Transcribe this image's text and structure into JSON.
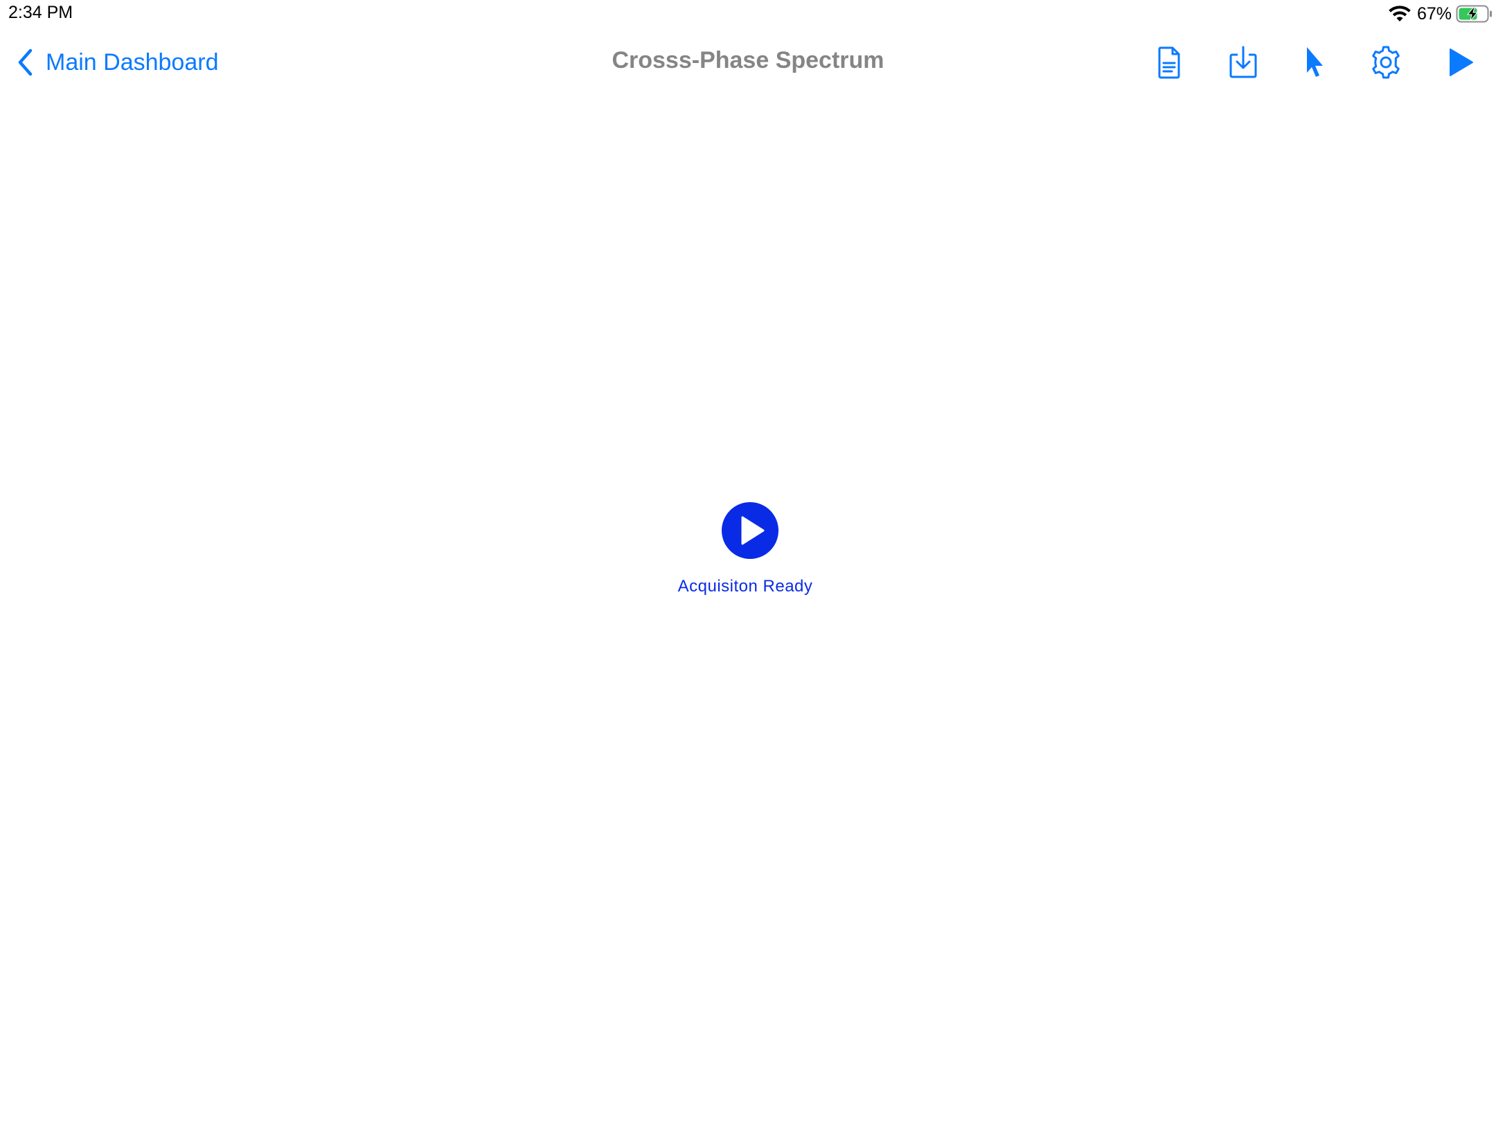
{
  "status_bar": {
    "time": "2:34 PM",
    "battery_percent": "67%",
    "battery_level": 0.67,
    "charging": true,
    "icons": [
      "wifi-icon",
      "battery-charging-icon"
    ]
  },
  "nav": {
    "back_label": "Main Dashboard",
    "title": "Crosss-Phase Spectrum",
    "toolbar_icons": [
      "document-icon",
      "download-icon",
      "pointer-icon",
      "gear-icon",
      "play-icon"
    ]
  },
  "center": {
    "status_text": "Acquisiton Ready",
    "icon": "play-circle-icon"
  },
  "colors": {
    "accent": "#0a7aff",
    "title": "#858585",
    "play_circle": "#0a2be6",
    "battery_fill": "#34c759"
  }
}
